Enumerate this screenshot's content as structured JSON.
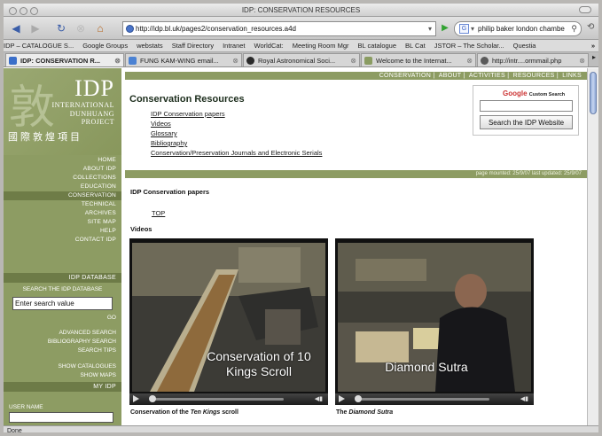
{
  "window": {
    "title": "IDP: CONSERVATION RESOURCES"
  },
  "navbar": {
    "url": "http://idp.bl.uk/pages2/conservation_resources.a4d",
    "search_value": "philip baker london chambe"
  },
  "bookmarks": [
    "IDP – CATALOGUE S...",
    "Google Groups",
    "webstats",
    "Staff Directory",
    "Intranet",
    "WorldCat:",
    "Meeting Room Mgr",
    "BL catalogue",
    "BL Cat",
    "JSTOR – The Scholar...",
    "Questia"
  ],
  "tabs": [
    {
      "label": "IDP: CONSERVATION R...",
      "active": true,
      "color": "#3b6fc9"
    },
    {
      "label": "FUNG KAM-WING email...",
      "active": false,
      "color": "#4b82d3"
    },
    {
      "label": "Royal Astronomical Soci...",
      "active": false,
      "color": "#2a2a2a"
    },
    {
      "label": "Welcome to the Internat...",
      "active": false,
      "color": "#8a9c62"
    },
    {
      "label": "http://intr....ormmail.php",
      "active": false,
      "color": "#5a5a5a"
    }
  ],
  "status": {
    "text": "Done"
  },
  "sidebar": {
    "logo_title": "IDP",
    "logo_sub": [
      "INTERNATIONAL",
      "DUNHUANG",
      "PROJECT"
    ],
    "logo_cn": "國際敦煌項目",
    "menu": [
      "HOME",
      "ABOUT IDP",
      "COLLECTIONS",
      "EDUCATION",
      "CONSERVATION",
      "TECHNICAL",
      "ARCHIVES",
      "SITE MAP",
      "HELP",
      "CONTACT IDP"
    ],
    "current": "CONSERVATION",
    "database_heading": "IDP DATABASE",
    "search_db_label": "SEARCH THE IDP DATABASE",
    "search_value": "Enter search value",
    "go": "GO",
    "db_links": [
      "ADVANCED SEARCH",
      "BIBLIOGRAPHY SEARCH",
      "SEARCH TIPS"
    ],
    "cat_links": [
      "SHOW CATALOGUES",
      "SHOW MAPS"
    ],
    "myidp_heading": "MY IDP",
    "username_label": "USER NAME"
  },
  "main": {
    "topnav": [
      "CONSERVATION",
      "ABOUT",
      "ACTIVITIES",
      "RESOURCES",
      "LINKS"
    ],
    "title": "Conservation Resources",
    "links": [
      "IDP Conservation papers",
      "Videos",
      "Glossary",
      "Bibliography",
      "Conservation/Preservation Journals and Electronic Serials"
    ],
    "google_logo": "Google",
    "google_cs": "Custom Search",
    "search_button": "Search the IDP Website",
    "page_info": "page mounted: 25/9/07 last updated: 25/9/07",
    "papers_heading": "IDP Conservation papers",
    "top_link": "TOP",
    "videos_heading": "Videos",
    "videos": [
      {
        "overlay": "Conservation of 10 Kings Scroll",
        "caption_pre": "Conservation of the ",
        "caption_em": "Ten Kings",
        "caption_post": " scroll"
      },
      {
        "overlay": "Diamond Sutra",
        "caption_pre": "The ",
        "caption_em": "Diamond Sutra",
        "caption_post": ""
      }
    ]
  }
}
